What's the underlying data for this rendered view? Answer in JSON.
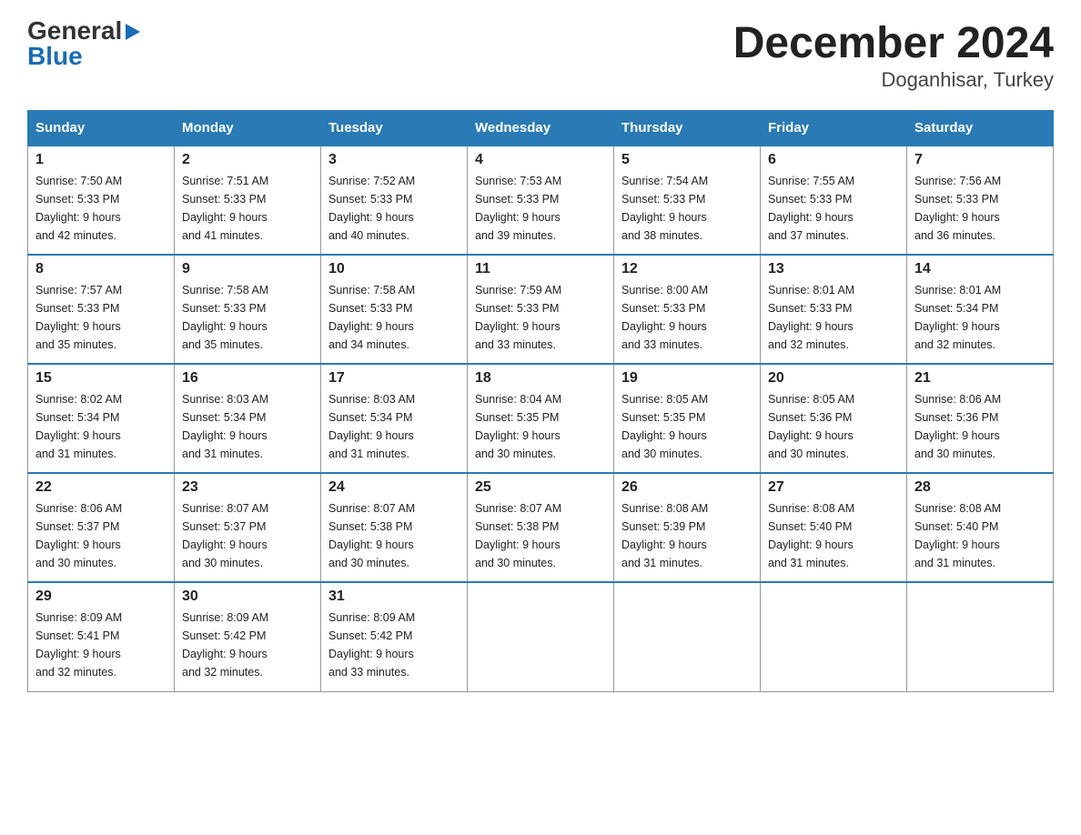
{
  "header": {
    "logo_general": "General",
    "logo_blue": "Blue",
    "title": "December 2024",
    "subtitle": "Doganhisar, Turkey"
  },
  "days_of_week": [
    "Sunday",
    "Monday",
    "Tuesday",
    "Wednesday",
    "Thursday",
    "Friday",
    "Saturday"
  ],
  "weeks": [
    [
      {
        "day": "1",
        "sunrise": "7:50 AM",
        "sunset": "5:33 PM",
        "daylight": "9 hours and 42 minutes."
      },
      {
        "day": "2",
        "sunrise": "7:51 AM",
        "sunset": "5:33 PM",
        "daylight": "9 hours and 41 minutes."
      },
      {
        "day": "3",
        "sunrise": "7:52 AM",
        "sunset": "5:33 PM",
        "daylight": "9 hours and 40 minutes."
      },
      {
        "day": "4",
        "sunrise": "7:53 AM",
        "sunset": "5:33 PM",
        "daylight": "9 hours and 39 minutes."
      },
      {
        "day": "5",
        "sunrise": "7:54 AM",
        "sunset": "5:33 PM",
        "daylight": "9 hours and 38 minutes."
      },
      {
        "day": "6",
        "sunrise": "7:55 AM",
        "sunset": "5:33 PM",
        "daylight": "9 hours and 37 minutes."
      },
      {
        "day": "7",
        "sunrise": "7:56 AM",
        "sunset": "5:33 PM",
        "daylight": "9 hours and 36 minutes."
      }
    ],
    [
      {
        "day": "8",
        "sunrise": "7:57 AM",
        "sunset": "5:33 PM",
        "daylight": "9 hours and 35 minutes."
      },
      {
        "day": "9",
        "sunrise": "7:58 AM",
        "sunset": "5:33 PM",
        "daylight": "9 hours and 35 minutes."
      },
      {
        "day": "10",
        "sunrise": "7:58 AM",
        "sunset": "5:33 PM",
        "daylight": "9 hours and 34 minutes."
      },
      {
        "day": "11",
        "sunrise": "7:59 AM",
        "sunset": "5:33 PM",
        "daylight": "9 hours and 33 minutes."
      },
      {
        "day": "12",
        "sunrise": "8:00 AM",
        "sunset": "5:33 PM",
        "daylight": "9 hours and 33 minutes."
      },
      {
        "day": "13",
        "sunrise": "8:01 AM",
        "sunset": "5:33 PM",
        "daylight": "9 hours and 32 minutes."
      },
      {
        "day": "14",
        "sunrise": "8:01 AM",
        "sunset": "5:34 PM",
        "daylight": "9 hours and 32 minutes."
      }
    ],
    [
      {
        "day": "15",
        "sunrise": "8:02 AM",
        "sunset": "5:34 PM",
        "daylight": "9 hours and 31 minutes."
      },
      {
        "day": "16",
        "sunrise": "8:03 AM",
        "sunset": "5:34 PM",
        "daylight": "9 hours and 31 minutes."
      },
      {
        "day": "17",
        "sunrise": "8:03 AM",
        "sunset": "5:34 PM",
        "daylight": "9 hours and 31 minutes."
      },
      {
        "day": "18",
        "sunrise": "8:04 AM",
        "sunset": "5:35 PM",
        "daylight": "9 hours and 30 minutes."
      },
      {
        "day": "19",
        "sunrise": "8:05 AM",
        "sunset": "5:35 PM",
        "daylight": "9 hours and 30 minutes."
      },
      {
        "day": "20",
        "sunrise": "8:05 AM",
        "sunset": "5:36 PM",
        "daylight": "9 hours and 30 minutes."
      },
      {
        "day": "21",
        "sunrise": "8:06 AM",
        "sunset": "5:36 PM",
        "daylight": "9 hours and 30 minutes."
      }
    ],
    [
      {
        "day": "22",
        "sunrise": "8:06 AM",
        "sunset": "5:37 PM",
        "daylight": "9 hours and 30 minutes."
      },
      {
        "day": "23",
        "sunrise": "8:07 AM",
        "sunset": "5:37 PM",
        "daylight": "9 hours and 30 minutes."
      },
      {
        "day": "24",
        "sunrise": "8:07 AM",
        "sunset": "5:38 PM",
        "daylight": "9 hours and 30 minutes."
      },
      {
        "day": "25",
        "sunrise": "8:07 AM",
        "sunset": "5:38 PM",
        "daylight": "9 hours and 30 minutes."
      },
      {
        "day": "26",
        "sunrise": "8:08 AM",
        "sunset": "5:39 PM",
        "daylight": "9 hours and 31 minutes."
      },
      {
        "day": "27",
        "sunrise": "8:08 AM",
        "sunset": "5:40 PM",
        "daylight": "9 hours and 31 minutes."
      },
      {
        "day": "28",
        "sunrise": "8:08 AM",
        "sunset": "5:40 PM",
        "daylight": "9 hours and 31 minutes."
      }
    ],
    [
      {
        "day": "29",
        "sunrise": "8:09 AM",
        "sunset": "5:41 PM",
        "daylight": "9 hours and 32 minutes."
      },
      {
        "day": "30",
        "sunrise": "8:09 AM",
        "sunset": "5:42 PM",
        "daylight": "9 hours and 32 minutes."
      },
      {
        "day": "31",
        "sunrise": "8:09 AM",
        "sunset": "5:42 PM",
        "daylight": "9 hours and 33 minutes."
      },
      null,
      null,
      null,
      null
    ]
  ],
  "labels": {
    "sunrise": "Sunrise:",
    "sunset": "Sunset:",
    "daylight": "Daylight:"
  }
}
